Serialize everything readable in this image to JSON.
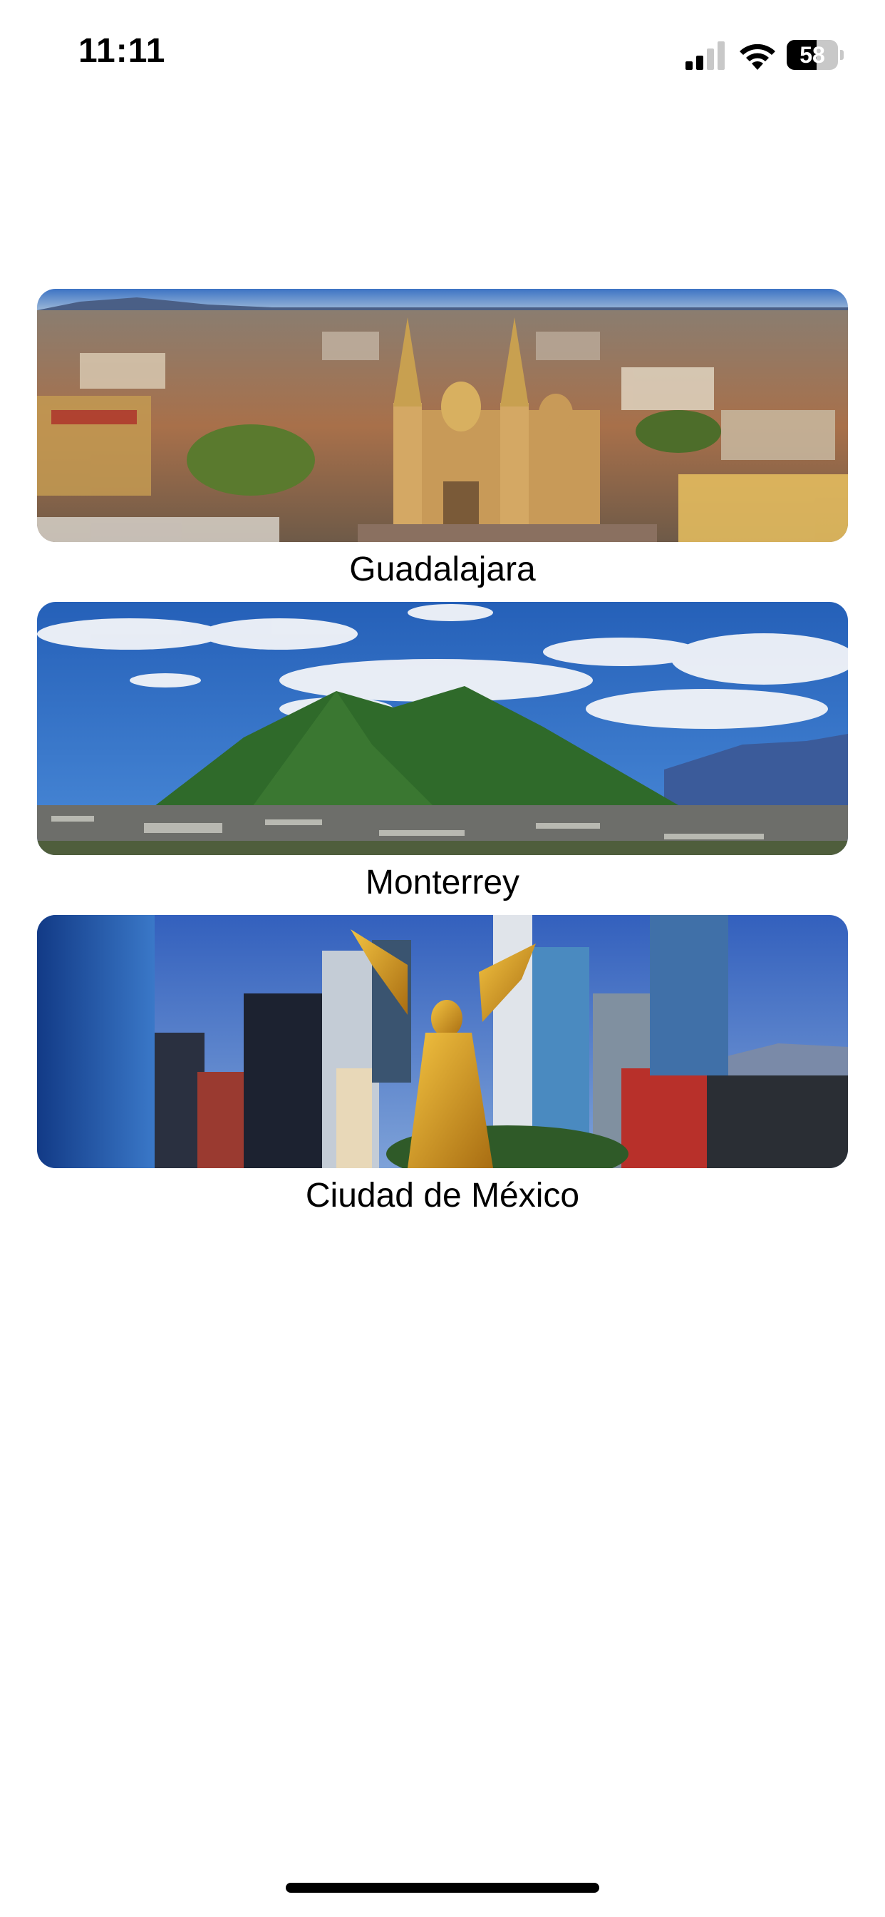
{
  "status_bar": {
    "time": "11:11",
    "battery_level": "58",
    "battery_fraction": 0.58,
    "signal_bars_active": 2,
    "signal_bars_total": 4
  },
  "cities": [
    {
      "name": "Guadalajara",
      "icon": "cathedral-aerial-photo"
    },
    {
      "name": "Monterrey",
      "icon": "mountain-landscape-photo"
    },
    {
      "name": "Ciudad de México",
      "icon": "skyline-angel-photo"
    }
  ],
  "colors": {
    "background": "#ffffff",
    "text": "#000000",
    "sky": "#2e6fc0"
  }
}
